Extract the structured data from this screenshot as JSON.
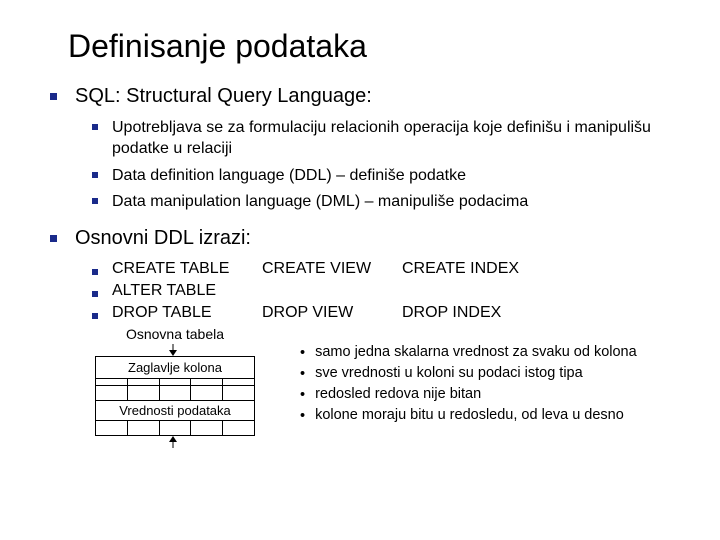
{
  "title": "Definisanje podataka",
  "sections": [
    {
      "label": "SQL: Structural Query Language:",
      "items": [
        "Upotrebljava se za formulaciju relacionih operacija koje definišu i manipulišu podatke u relaciji",
        "Data definition language (DDL) – definiše podatke",
        "Data manipulation language (DML) – manipuliše podacima"
      ]
    },
    {
      "label": "Osnovni DDL izrazi:"
    }
  ],
  "ddl_grid": {
    "rows": [
      [
        "CREATE TABLE",
        "CREATE VIEW",
        "CREATE INDEX"
      ],
      [
        "ALTER TABLE",
        "",
        ""
      ],
      [
        "DROP TABLE",
        "DROP VIEW",
        "DROP INDEX"
      ]
    ]
  },
  "diagram": {
    "title": "Osnovna tabela",
    "header_label": "Zaglavlje kolona",
    "body_label": "Vrednosti podataka"
  },
  "notes": [
    "samo jedna skalarna vrednost za svaku od kolona",
    "sve vrednosti u koloni su podaci istog tipa",
    "redosled redova nije bitan",
    "kolone moraju bitu u redosledu, od leva u desno"
  ]
}
